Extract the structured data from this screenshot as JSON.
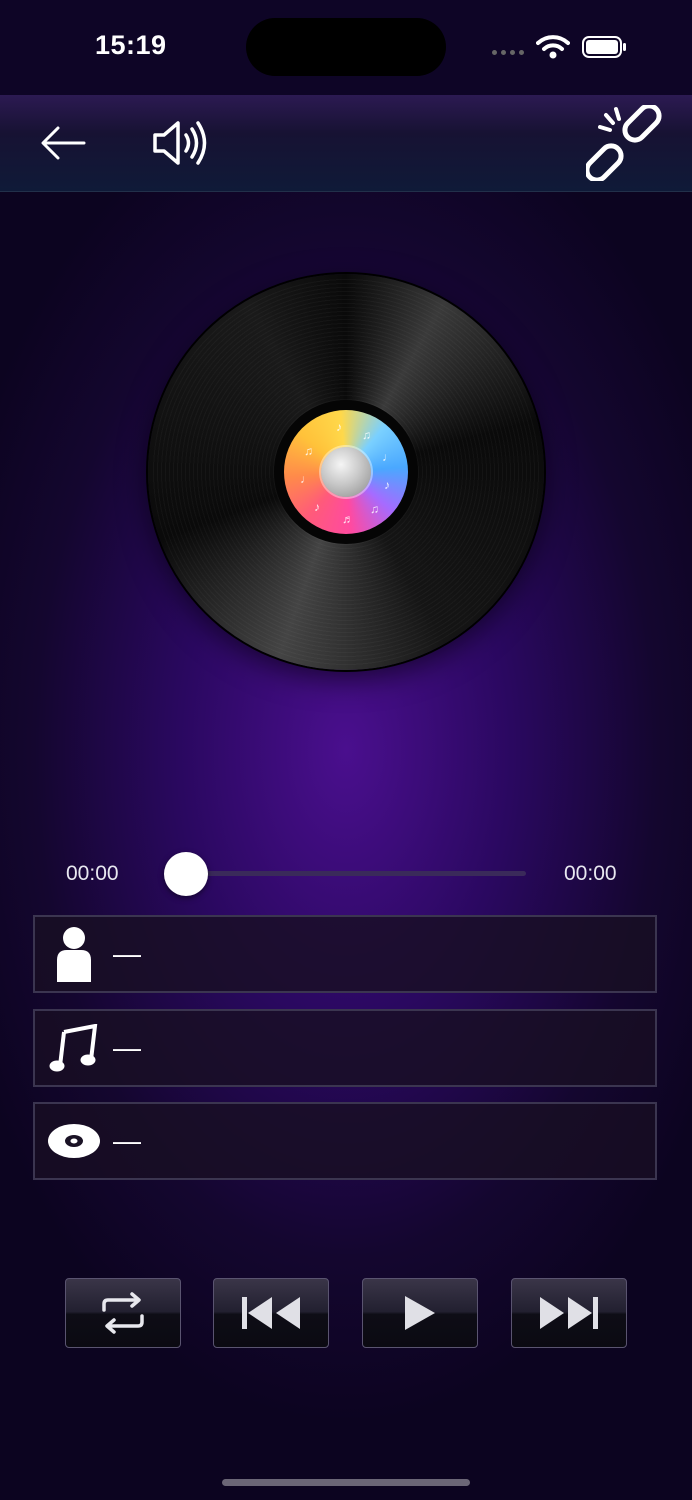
{
  "status_bar": {
    "time": "15:19"
  },
  "nav": {
    "back_icon": "arrow-left-icon",
    "volume_icon": "speaker-icon",
    "link_icon": "broken-link-icon"
  },
  "player": {
    "current_time": "00:00",
    "total_time": "00:00",
    "progress": 0
  },
  "track_info": {
    "artist": "—",
    "title": "—",
    "album": "—"
  },
  "controls": [
    "repeat-icon",
    "previous-icon",
    "play-icon",
    "next-icon"
  ],
  "colors": {
    "accent": "#4a0f8e",
    "background": "#14062f"
  }
}
